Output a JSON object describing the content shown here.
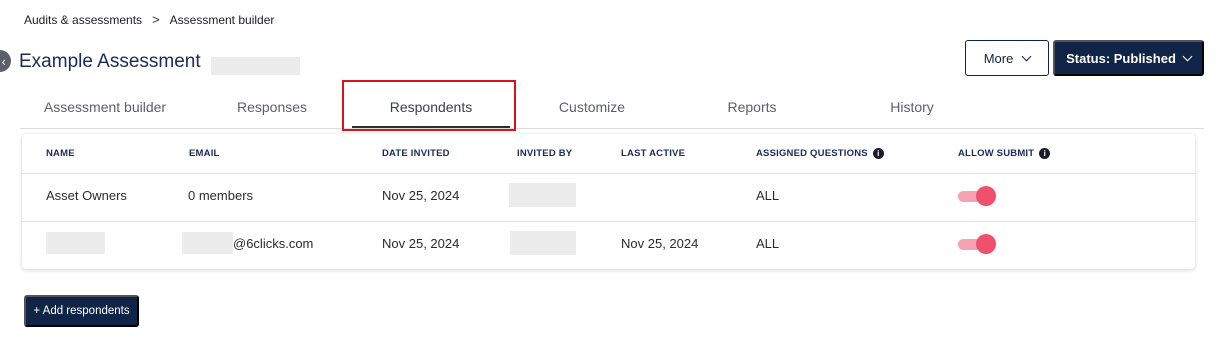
{
  "breadcrumb": {
    "items": [
      "Audits & assessments",
      "Assessment builder"
    ],
    "separator": ">"
  },
  "header": {
    "title": "Example Assessment",
    "back_icon": "chevron-left-icon"
  },
  "actions": {
    "more_label": "More",
    "status_label": "Status: Published"
  },
  "tabs": [
    {
      "label": "Assessment builder"
    },
    {
      "label": "Responses"
    },
    {
      "label": "Respondents",
      "active": true
    },
    {
      "label": "Customize"
    },
    {
      "label": "Reports"
    },
    {
      "label": "History"
    }
  ],
  "table": {
    "columns": {
      "name": "NAME",
      "email": "EMAIL",
      "date_invited": "DATE INVITED",
      "invited_by": "INVITED BY",
      "last_active": "LAST ACTIVE",
      "assigned_questions": "ASSIGNED QUESTIONS",
      "allow_submit": "ALLOW SUBMIT"
    },
    "rows": [
      {
        "name": "Asset Owners",
        "email": "0 members",
        "date_invited": "Nov 25, 2024",
        "invited_by": "",
        "last_active": "",
        "assigned_questions": "ALL",
        "allow_submit": true
      },
      {
        "name": "",
        "email": "@6clicks.com",
        "date_invited": "Nov 25, 2024",
        "invited_by": "",
        "last_active": "Nov 25, 2024",
        "assigned_questions": "ALL",
        "allow_submit": true
      }
    ]
  },
  "footer": {
    "add_label": "+ Add respondents"
  },
  "colors": {
    "brand_navy": "#0f2447",
    "title_blue": "#1d2a5b",
    "toggle_on": "#f0506e",
    "highlight_red": "#d9131b"
  }
}
